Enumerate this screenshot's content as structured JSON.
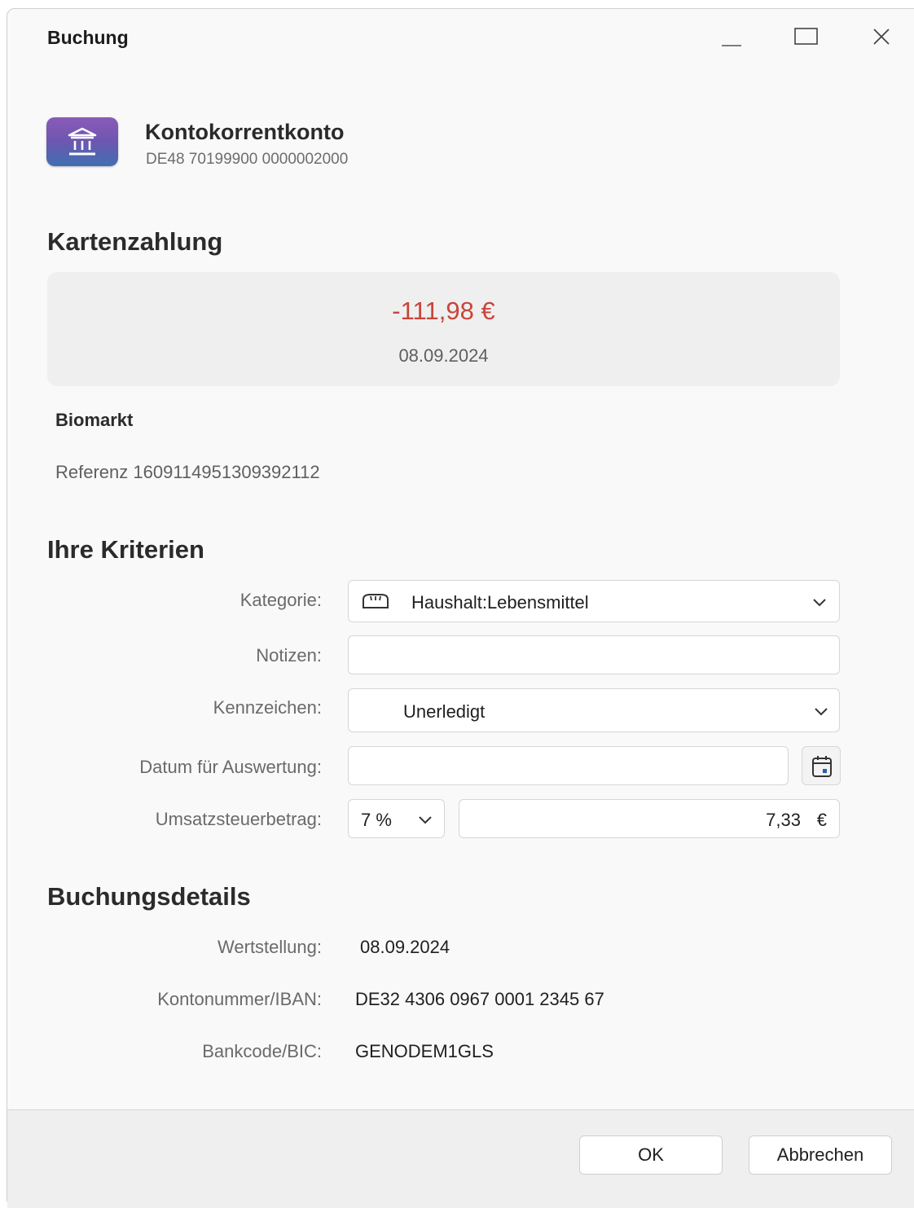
{
  "window": {
    "title": "Buchung"
  },
  "account": {
    "icon": "bank-icon",
    "name": "Kontokorrentkonto",
    "iban": "DE48 70199900 0000002000"
  },
  "transaction": {
    "type_title": "Kartenzahlung",
    "amount": "-111,98 €",
    "amount_color": "#c8453a",
    "date": "08.09.2024",
    "payee": "Biomarkt",
    "reference": "Referenz 1609114951309392112"
  },
  "criteria": {
    "title": "Ihre Kriterien",
    "category_label": "Kategorie:",
    "category_value": "Haushalt:Lebensmittel",
    "category_icon": "bread-icon",
    "notes_label": "Notizen:",
    "notes_value": "",
    "flag_label": "Kennzeichen:",
    "flag_value": "Unerledigt",
    "eval_date_label": "Datum für Auswertung:",
    "eval_date_value": "",
    "vat_label": "Umsatzsteuerbetrag:",
    "vat_rate": "7 %",
    "vat_amount": "7,33",
    "vat_currency": "€"
  },
  "details": {
    "title": "Buchungsdetails",
    "value_date_label": "Wertstellung:",
    "value_date": "08.09.2024",
    "iban_label": "Kontonummer/IBAN:",
    "iban": "DE32 4306 0967 0001 2345 67",
    "bic_label": "Bankcode/BIC:",
    "bic": "GENODEM1GLS"
  },
  "buttons": {
    "ok": "OK",
    "cancel": "Abbrechen"
  }
}
